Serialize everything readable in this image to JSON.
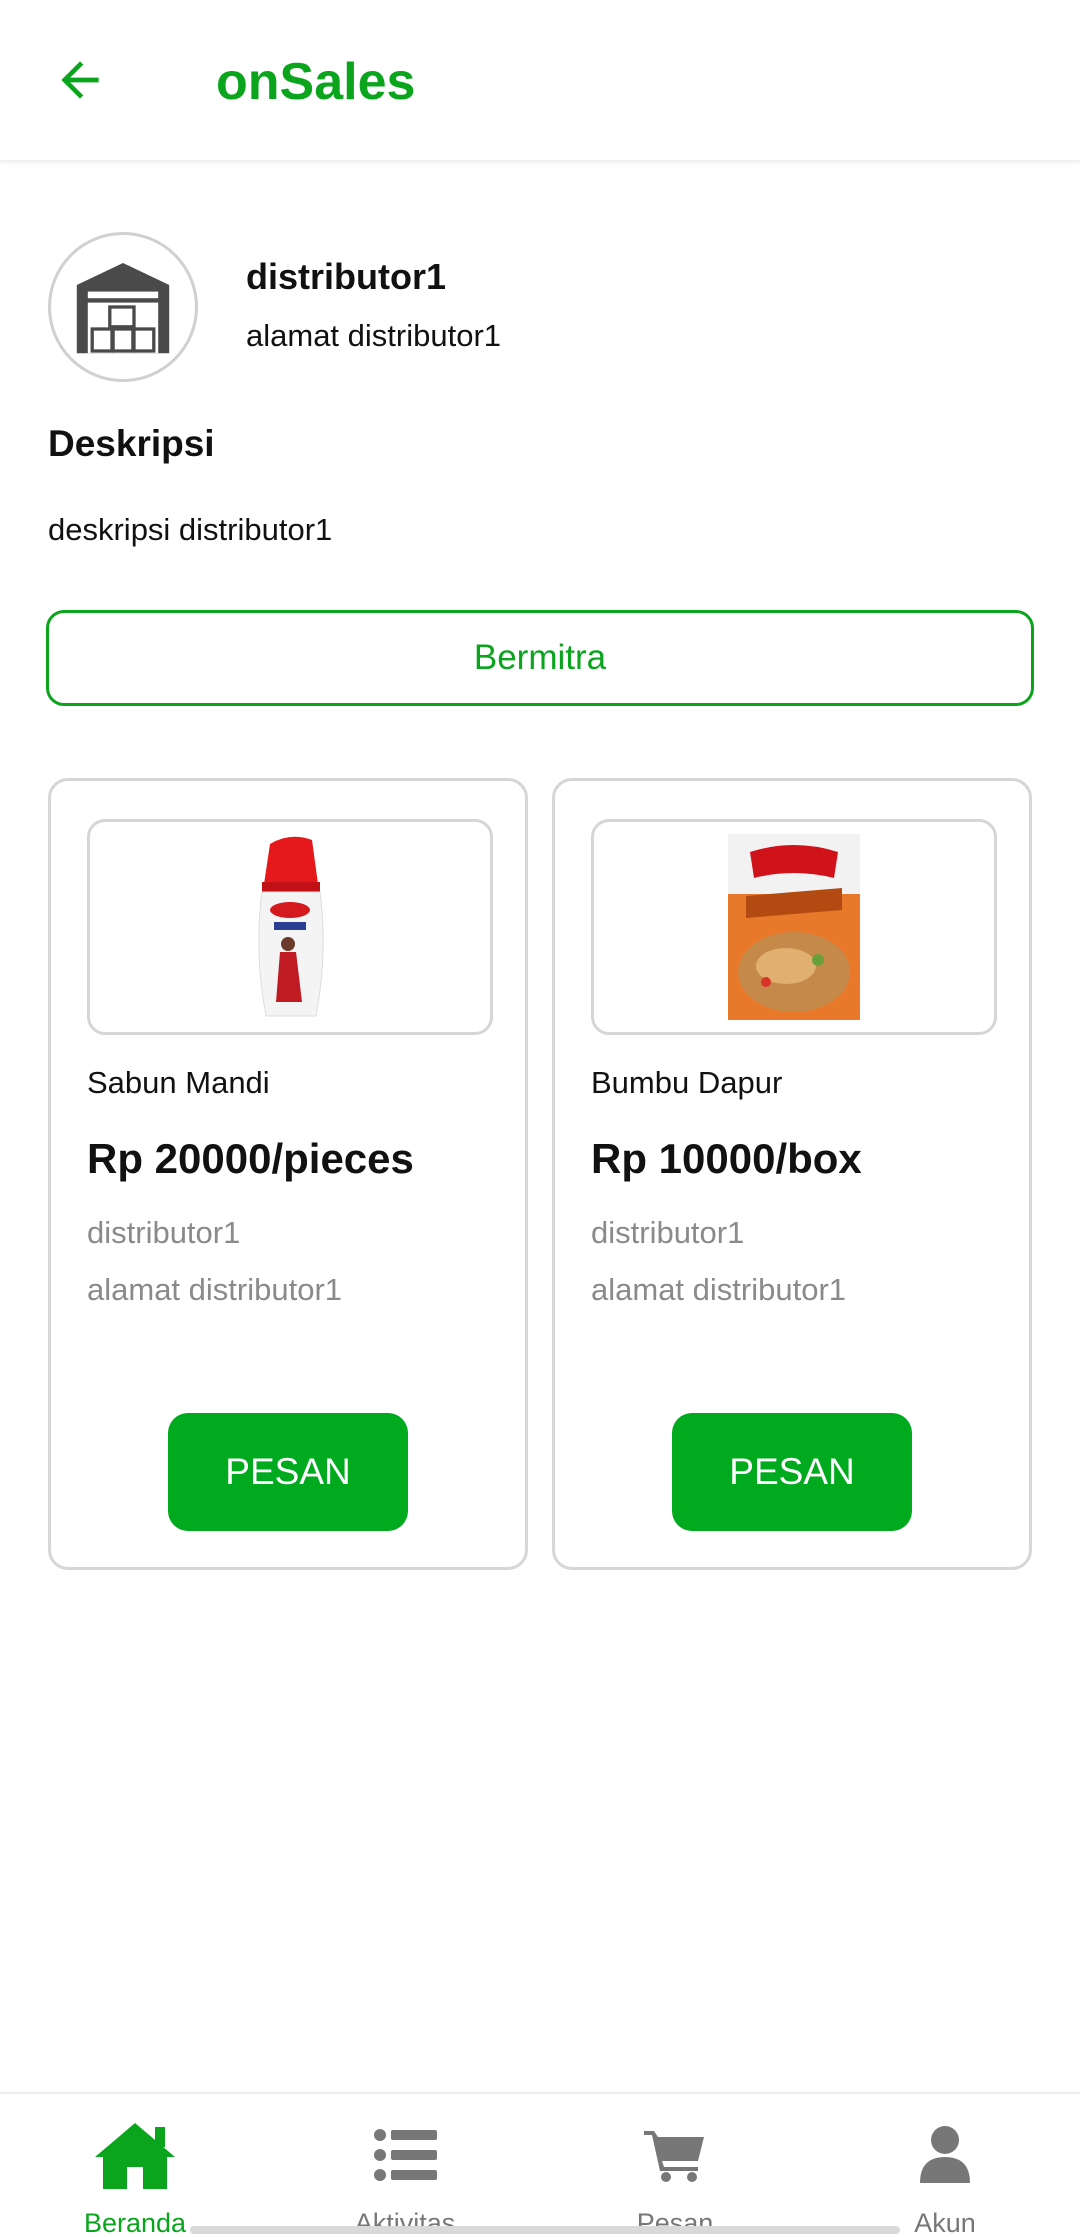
{
  "header": {
    "title": "onSales"
  },
  "distributor": {
    "name": "distributor1",
    "address": "alamat distributor1",
    "description_heading": "Deskripsi",
    "description": "deskripsi distributor1"
  },
  "partner_button": "Bermitra",
  "products": [
    {
      "name": "Sabun Mandi",
      "price": "Rp 20000/pieces",
      "distributor": "distributor1",
      "address": "alamat distributor1",
      "order_label": "PESAN"
    },
    {
      "name": "Bumbu Dapur",
      "price": "Rp 10000/box",
      "distributor": "distributor1",
      "address": "alamat distributor1",
      "order_label": "PESAN"
    }
  ],
  "bottom_nav": [
    {
      "label": "Beranda",
      "icon": "home-icon",
      "active": true
    },
    {
      "label": "Aktivitas",
      "icon": "list-icon",
      "active": false
    },
    {
      "label": "Pesan",
      "icon": "cart-icon",
      "active": false
    },
    {
      "label": "Akun",
      "icon": "user-icon",
      "active": false
    }
  ],
  "colors": {
    "accent": "#0aa51d",
    "button": "#00aa1e",
    "muted": "#8a8a8a",
    "border": "#d6d6d6"
  }
}
